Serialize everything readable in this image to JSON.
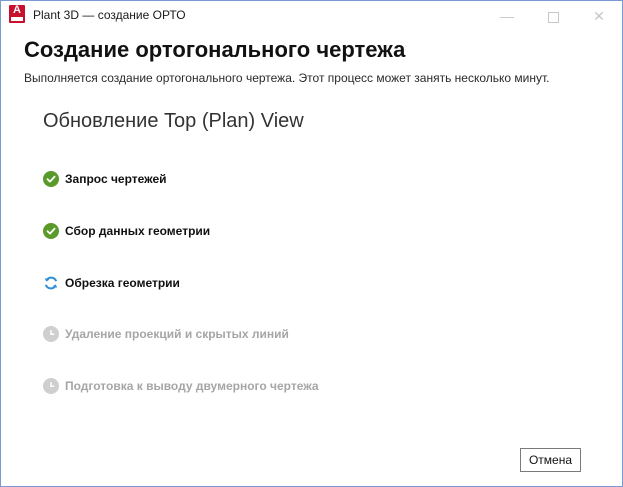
{
  "window": {
    "title": "Plant 3D — создание ОРТО",
    "app_icon_letter": "A"
  },
  "header": {
    "title": "Создание ортогонального чертежа",
    "subtitle": "Выполняется создание ортогонального чертежа. Этот процесс может занять несколько минут."
  },
  "progress": {
    "current_stage": "Обновление Top (Plan) View",
    "steps": [
      {
        "label": "Запрос чертежей",
        "status": "done",
        "icon": "check-circle-icon"
      },
      {
        "label": "Сбор данных геометрии",
        "status": "done",
        "icon": "check-circle-icon"
      },
      {
        "label": "Обрезка геометрии",
        "status": "in-progress",
        "icon": "refresh-icon"
      },
      {
        "label": "Удаление проекций и скрытых линий",
        "status": "pending",
        "icon": "clock-icon"
      },
      {
        "label": "Подготовка к выводу двумерного чертежа",
        "status": "pending",
        "icon": "clock-icon"
      }
    ]
  },
  "footer": {
    "cancel_label": "Отмена"
  },
  "colors": {
    "done": "#5a9a2b",
    "active": "#2f8fd6",
    "pending": "#cfcfcf",
    "app_icon": "#c8102e"
  }
}
